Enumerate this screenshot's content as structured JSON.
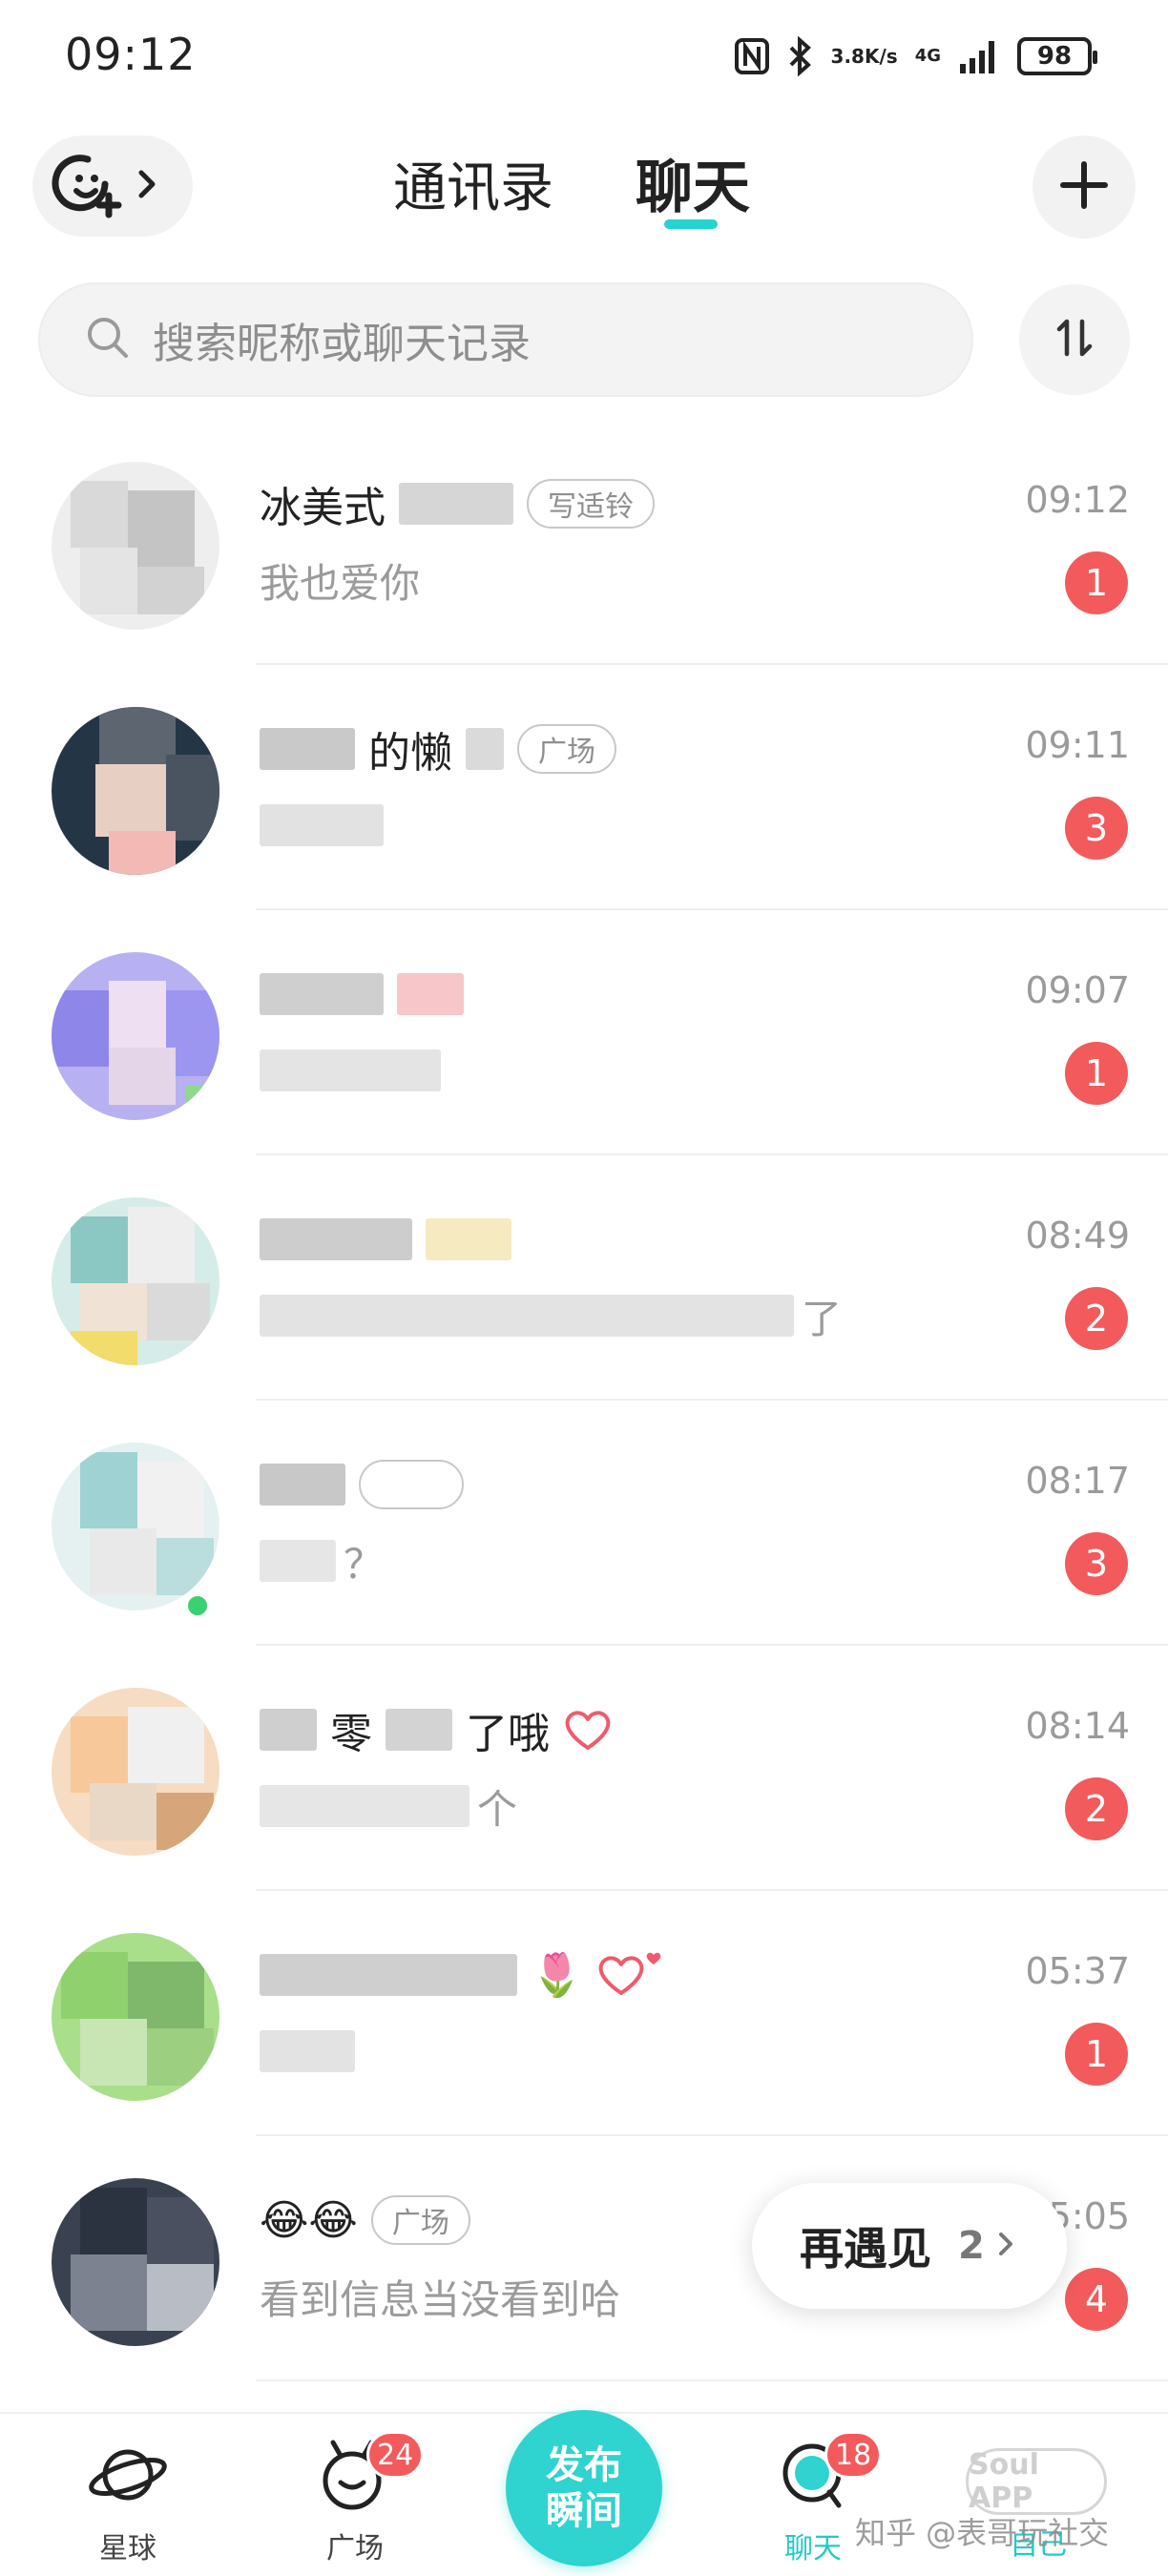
{
  "status_bar": {
    "time": "09:12",
    "speed_value": "3.8",
    "speed_unit": "K/s",
    "network": "4G",
    "battery": "98"
  },
  "header": {
    "tabs": [
      {
        "label": "通讯录",
        "active": false
      },
      {
        "label": "聊天",
        "active": true
      }
    ]
  },
  "search": {
    "placeholder": "搜索昵称或聊天记录"
  },
  "chats": [
    {
      "name": "冰美式",
      "tag": "写适铃",
      "message": "我也爱你",
      "time": "09:12",
      "unread": "1"
    },
    {
      "name": "的懒",
      "tag": "广场",
      "message": "",
      "time": "09:11",
      "unread": "3"
    },
    {
      "name": "",
      "tag": "",
      "message": "",
      "time": "09:07",
      "unread": "1"
    },
    {
      "name": "",
      "tag": "",
      "message": "了",
      "time": "08:49",
      "unread": "2"
    },
    {
      "name": "",
      "tag": "",
      "message": "？",
      "time": "08:17",
      "unread": "3",
      "online": true
    },
    {
      "name": "零",
      "name_suffix": "了哦",
      "tag": "",
      "message": "个",
      "time": "08:14",
      "unread": "2",
      "heart": true
    },
    {
      "name": "",
      "tag": "",
      "message": "",
      "time": "05:37",
      "unread": "1",
      "heart": true
    },
    {
      "name": "😂😂",
      "tag": "广场",
      "message": "看到信息当没看到哈",
      "time": "05:05",
      "unread": "4"
    }
  ],
  "meet_pill": {
    "label": "再遇见",
    "count": "2"
  },
  "bottom_nav": {
    "items": [
      {
        "label": "星球",
        "badge": "",
        "active": false
      },
      {
        "label": "广场",
        "badge": "24",
        "active": false
      },
      {
        "label": "聊天",
        "badge": "18",
        "active": true
      },
      {
        "label": "自己",
        "badge": "",
        "active": false
      }
    ],
    "publish_line1": "发布",
    "publish_line2": "瞬间",
    "soul_app_label": "Soul APP"
  },
  "watermark": "知乎 @表哥玩社交",
  "colors": {
    "accent": "#2fd3cf",
    "badge": "#f25a5c",
    "muted_text": "#9a9a9a"
  }
}
